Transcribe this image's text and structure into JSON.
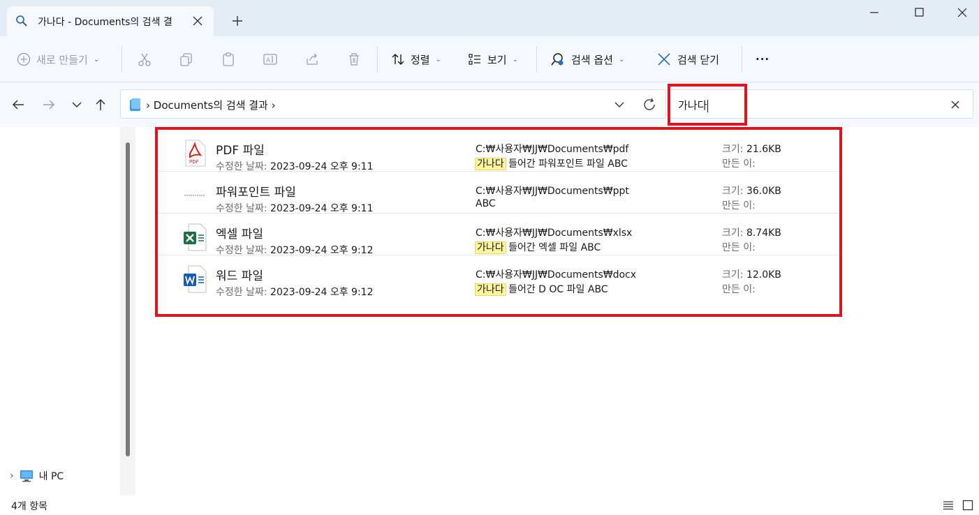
{
  "window": {
    "tab_title": "가나다 - Documents의 검색 결",
    "new_tab": "+"
  },
  "toolbar": {
    "new_label": "새로 만들기",
    "sort_label": "정렬",
    "view_label": "보기",
    "search_options_label": "검색 옵션",
    "close_search_label": "검색 닫기",
    "more_label": "···"
  },
  "navigation": {
    "breadcrumb": "Documents의 검색 결과",
    "search_value": "가나다"
  },
  "sidebar": {
    "items": [
      {
        "label": "내 PC"
      }
    ]
  },
  "labels": {
    "modified": "수정한 날짜:",
    "size": "크기:",
    "author": "만든 이:"
  },
  "files": [
    {
      "name": "PDF 파일",
      "icon": "pdf-icon",
      "modified": "2023-09-24 오후 9:11",
      "path": "C:₩사용자₩JJ₩Documents₩pdf",
      "highlight": "가나다",
      "desc": " 들어간 파워포인트 파일 ABC",
      "size": "21.6KB"
    },
    {
      "name": "파워포인트 파일",
      "icon": "pptx-thumbnail-icon",
      "modified": "2023-09-24 오후 9:11",
      "path": "C:₩사용자₩JJ₩Documents₩ppt",
      "highlight": "",
      "desc": "ABC",
      "size": "36.0KB"
    },
    {
      "name": "엑셀 파일",
      "icon": "excel-icon",
      "modified": "2023-09-24 오후 9:12",
      "path": "C:₩사용자₩JJ₩Documents₩xlsx",
      "highlight": "가나다",
      "desc": " 들어간 엑셀 파일 ABC",
      "size": "8.74KB"
    },
    {
      "name": "워드 파일",
      "icon": "word-icon",
      "modified": "2023-09-24 오후 9:12",
      "path": "C:₩사용자₩JJ₩Documents₩docx",
      "highlight": "가나다",
      "desc": " 들어간 D OC 파일 ABC",
      "size": "12.0KB"
    }
  ],
  "status": {
    "item_count": "4개 항목"
  },
  "colors": {
    "annotation_red": "#e0141e",
    "highlight_yellow": "#fff59d",
    "excel_green": "#1d7044",
    "word_blue": "#185abd",
    "pdf_red": "#d5231a"
  }
}
